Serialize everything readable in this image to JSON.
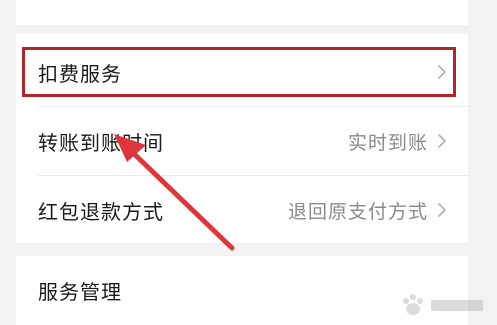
{
  "settings": {
    "items": [
      {
        "label": "扣费服务",
        "value": ""
      },
      {
        "label": "转账到账时间",
        "value": "实时到账"
      },
      {
        "label": "红包退款方式",
        "value": "退回原支付方式"
      }
    ],
    "bottom_items": [
      {
        "label": "服务管理",
        "value": ""
      }
    ]
  },
  "annotation": {
    "highlight_color": "#b3252a",
    "arrow_color": "#e0363b"
  },
  "icons": {
    "chevron": "chevron-right-icon",
    "watermark": "baidu-jingyan-watermark"
  }
}
